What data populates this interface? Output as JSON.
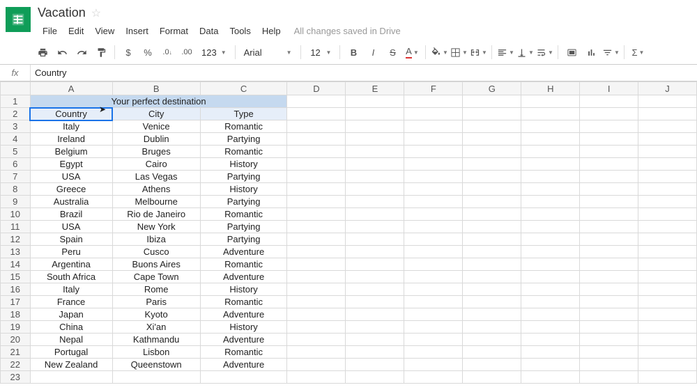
{
  "doc": {
    "title": "Vacation",
    "save_status": "All changes saved in Drive"
  },
  "menus": [
    "File",
    "Edit",
    "View",
    "Insert",
    "Format",
    "Data",
    "Tools",
    "Help"
  ],
  "toolbar": {
    "font_name": "Arial",
    "font_size": "12",
    "currency": "$",
    "percent": "%",
    "dec_dec": ".0",
    "dec_inc": ".00",
    "more_fmt": "123"
  },
  "formula": {
    "fx": "fx",
    "value": "Country"
  },
  "columns": [
    "A",
    "B",
    "C",
    "D",
    "E",
    "F",
    "G",
    "H",
    "I",
    "J"
  ],
  "sheet": {
    "title": "Your perfect destination",
    "headers": {
      "a": "Country",
      "b": "City",
      "c": "Type"
    },
    "rows": [
      {
        "a": "Italy",
        "b": "Venice",
        "c": "Romantic"
      },
      {
        "a": "Ireland",
        "b": "Dublin",
        "c": "Partying"
      },
      {
        "a": "Belgium",
        "b": "Bruges",
        "c": "Romantic"
      },
      {
        "a": "Egypt",
        "b": "Cairo",
        "c": "History"
      },
      {
        "a": "USA",
        "b": "Las Vegas",
        "c": "Partying"
      },
      {
        "a": "Greece",
        "b": "Athens",
        "c": "History"
      },
      {
        "a": "Australia",
        "b": "Melbourne",
        "c": "Partying"
      },
      {
        "a": "Brazil",
        "b": "Rio de Janeiro",
        "c": "Romantic"
      },
      {
        "a": "USA",
        "b": "New York",
        "c": "Partying"
      },
      {
        "a": "Spain",
        "b": "Ibiza",
        "c": "Partying"
      },
      {
        "a": "Peru",
        "b": "Cusco",
        "c": "Adventure"
      },
      {
        "a": "Argentina",
        "b": "Buons Aires",
        "c": "Romantic"
      },
      {
        "a": "South Africa",
        "b": "Cape Town",
        "c": "Adventure"
      },
      {
        "a": "Italy",
        "b": "Rome",
        "c": "History"
      },
      {
        "a": "France",
        "b": "Paris",
        "c": "Romantic"
      },
      {
        "a": "Japan",
        "b": "Kyoto",
        "c": "Adventure"
      },
      {
        "a": "China",
        "b": "Xi'an",
        "c": "History"
      },
      {
        "a": "Nepal",
        "b": "Kathmandu",
        "c": "Adventure"
      },
      {
        "a": "Portugal",
        "b": "Lisbon",
        "c": "Romantic"
      },
      {
        "a": "New Zealand",
        "b": "Queenstown",
        "c": "Adventure"
      }
    ]
  },
  "selected_cell": "A2"
}
